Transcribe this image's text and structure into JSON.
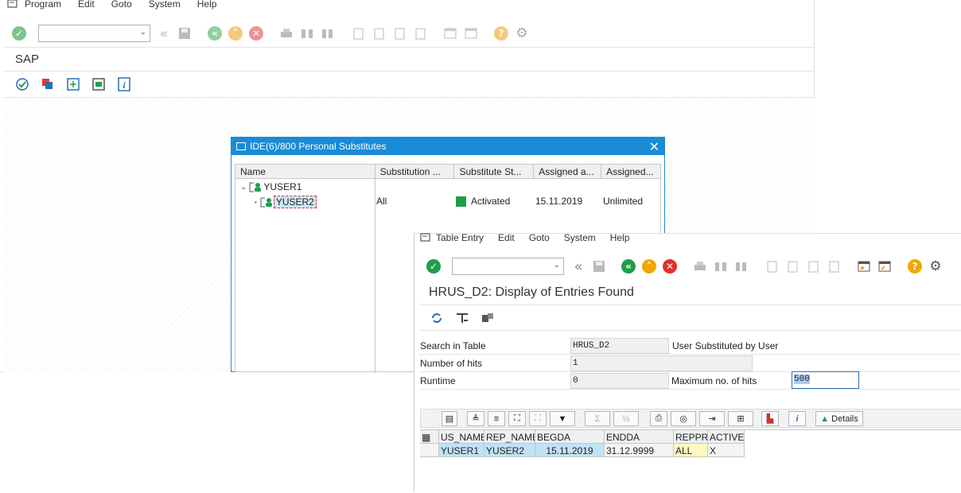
{
  "main": {
    "menu": [
      "Program",
      "Edit",
      "Goto",
      "System",
      "Help"
    ],
    "title": "SAP",
    "command_field": ""
  },
  "dialog": {
    "title": "IDE(6)/800 Personal Substitutes",
    "columns": [
      "Name",
      "Substitution ...",
      "Substitute St...",
      "Assigned a...",
      "Assigned..."
    ],
    "tree": {
      "parent": "YUSER1",
      "child": "YUSER2",
      "child_subst": "All",
      "child_status": "Activated",
      "child_assigned_at": "15.11.2019",
      "child_assigned_until": "Unlimited"
    },
    "status_color": "#1e9e4a"
  },
  "win2": {
    "menu": [
      "Table Entry",
      "Edit",
      "Goto",
      "System",
      "Help"
    ],
    "title": "HRUS_D2: Display of Entries Found",
    "form": {
      "search_label": "Search in Table",
      "search_value": "HRUS_D2",
      "search_desc": "User Substituted by User",
      "hits_label": "Number of hits",
      "hits_value": "1",
      "runtime_label": "Runtime",
      "runtime_value": "0",
      "max_label": "Maximum no. of hits",
      "max_value": "500"
    },
    "details_label": "Details",
    "grid": {
      "columns": [
        "US_NAME",
        "REP_NAME",
        "BEGDA",
        "ENDDA",
        "REPPR",
        "ACTIVE"
      ],
      "rows": [
        [
          "YUSER1",
          "YUSER2",
          "15.11.2019",
          "31.12.9999",
          "ALL",
          "X"
        ]
      ]
    }
  }
}
